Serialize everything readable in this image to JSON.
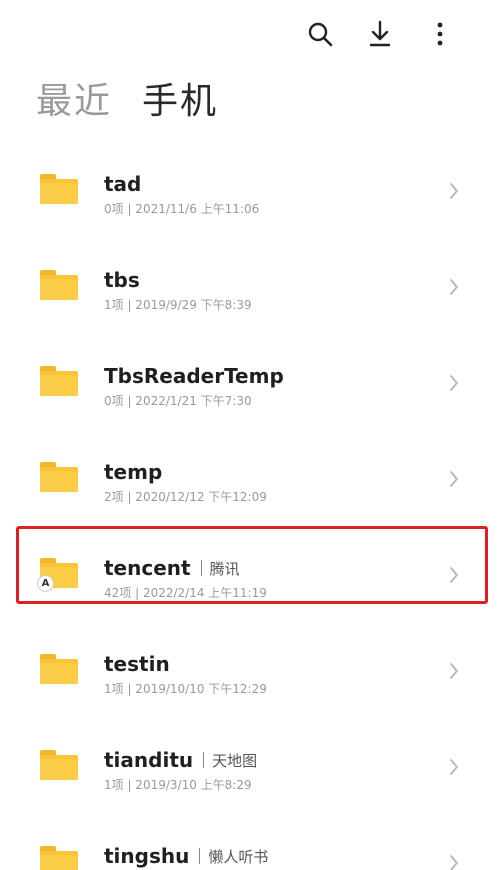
{
  "toolbar": {
    "search_icon": "search-icon",
    "download_icon": "download-icon",
    "more_icon": "more-vertical-icon"
  },
  "tabs": [
    {
      "label": "最近",
      "active": false
    },
    {
      "label": "手机",
      "active": true
    }
  ],
  "files": [
    {
      "name": "tad",
      "alias": "",
      "meta": "0项 | 2021/11/6 上午11:06",
      "badge": ""
    },
    {
      "name": "tbs",
      "alias": "",
      "meta": "1项 | 2019/9/29 下午8:39",
      "badge": ""
    },
    {
      "name": "TbsReaderTemp",
      "alias": "",
      "meta": "0项 | 2022/1/21 下午7:30",
      "badge": ""
    },
    {
      "name": "temp",
      "alias": "",
      "meta": "2项 | 2020/12/12 下午12:09",
      "badge": ""
    },
    {
      "name": "tencent",
      "alias": "腾讯",
      "meta": "42项 | 2022/2/14 上午11:19",
      "badge": "A"
    },
    {
      "name": "testin",
      "alias": "",
      "meta": "1项 | 2019/10/10 下午12:29",
      "badge": ""
    },
    {
      "name": "tianditu",
      "alias": "天地图",
      "meta": "1项 | 2019/3/10 上午8:29",
      "badge": ""
    },
    {
      "name": "tingshu",
      "alias": "懒人听书",
      "meta": "",
      "badge": ""
    }
  ],
  "highlight_color": "#e02020",
  "folder_color": "#f7c536"
}
